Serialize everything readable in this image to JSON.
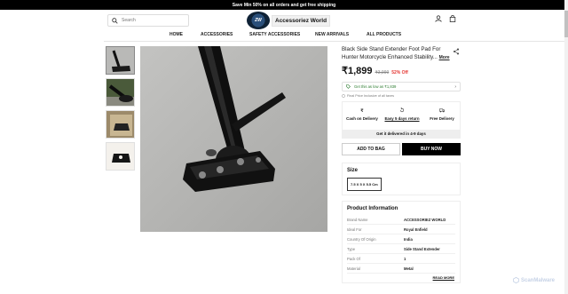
{
  "promo": "Save Min 50% on all orders and get free shipping",
  "search": {
    "placeholder": "Search"
  },
  "brand": {
    "badge": "ZW",
    "name": "Accessoriez World"
  },
  "nav": [
    "HOME",
    "ACCESSORIES",
    "SAFETY ACCESSORIES",
    "NEW ARRIVALS",
    "ALL PRODUCTS"
  ],
  "product": {
    "title": "Black Side Stand Extender Foot Pad For Hunter Motorcycle Enhanced Stability...",
    "more": "More",
    "price": "₹1,899",
    "mrp": "₹3,999",
    "off": "52% Off",
    "offer": "Get this as low as ₹1,839",
    "inclusive": "Final Price Inclusive of all taxes",
    "features": [
      "Cash on Delivery",
      "Easy 5 days return",
      "Free Delivery"
    ],
    "delivery": "Get it delivered in 4-9 days",
    "add_to_bag": "ADD TO BAG",
    "buy_now": "BUY NOW",
    "size_heading": "Size",
    "size_option": "7.5 X 5 X 5.5 Cm",
    "info_heading": "Product Information",
    "info": [
      {
        "k": "Brand Name",
        "v": "ACCESSORIEZ WORLD"
      },
      {
        "k": "Ideal For",
        "v": "Royal Enfield"
      },
      {
        "k": "Country Of Origin",
        "v": "India"
      },
      {
        "k": "Type",
        "v": "Side Stand Extender"
      },
      {
        "k": "Pack Of",
        "v": "1"
      },
      {
        "k": "Material",
        "v": "Metal"
      }
    ],
    "read_more": "READ MORE"
  },
  "watermark": "ScanMalware",
  "icons": [
    "search-icon",
    "user-icon",
    "bag-icon",
    "share-icon",
    "tag-icon",
    "chevron-right-icon",
    "info-icon",
    "cash-icon",
    "return-icon",
    "truck-icon"
  ]
}
